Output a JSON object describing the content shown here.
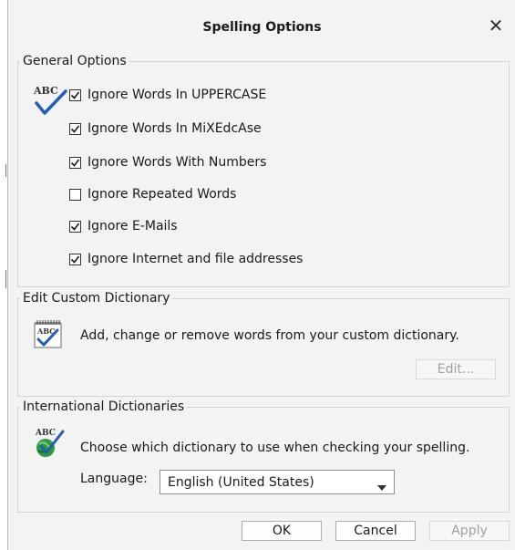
{
  "dialog": {
    "title": "Spelling Options",
    "close_glyph": "✕"
  },
  "general": {
    "legend": "General Options",
    "icon": "abc-check-icon",
    "options": [
      {
        "label": "Ignore Words In UPPERCASE",
        "checked": true
      },
      {
        "label": "Ignore Words In MiXEdcAse",
        "checked": true
      },
      {
        "label": "Ignore Words With Numbers",
        "checked": true
      },
      {
        "label": "Ignore Repeated Words",
        "checked": false
      },
      {
        "label": "Ignore E-Mails",
        "checked": true
      },
      {
        "label": "Ignore Internet and file addresses",
        "checked": true
      }
    ]
  },
  "custom_dictionary": {
    "legend": "Edit Custom Dictionary",
    "icon": "dictionary-notepad-icon",
    "description": "Add, change or remove words from your custom dictionary.",
    "edit_label": "Edit..."
  },
  "international": {
    "legend": "International Dictionaries",
    "icon": "abc-globe-icon",
    "description": "Choose which dictionary to use when checking your spelling.",
    "language_label": "Language:",
    "language_value": "English (United States)"
  },
  "footer": {
    "ok_label": "OK",
    "cancel_label": "Cancel",
    "apply_label": "Apply"
  },
  "colors": {
    "check_blue": "#1f5fb5",
    "dialog_bg": "#f3f3f3",
    "globe_green": "#2e9a3e"
  }
}
